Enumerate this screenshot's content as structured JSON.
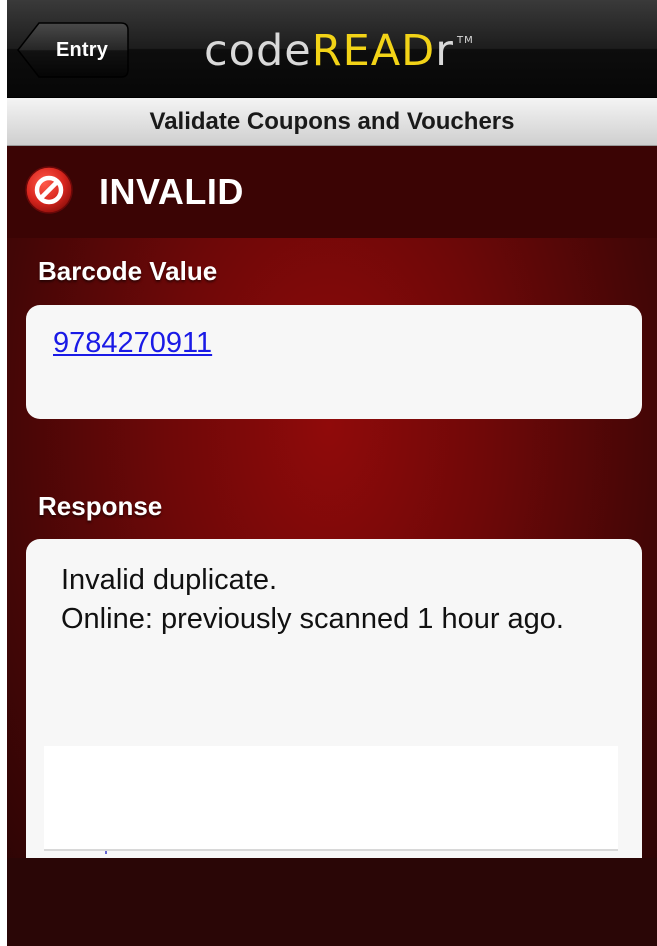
{
  "navbar": {
    "back_label": "Entry",
    "logo_code": "code",
    "logo_read": "READ",
    "logo_r": "r",
    "logo_tm": "TM"
  },
  "subtitle": "Validate Coupons and Vouchers",
  "status": {
    "icon": "no-entry-icon",
    "text": "INVALID"
  },
  "barcode": {
    "label": "Barcode Value",
    "value": "9784270911"
  },
  "response": {
    "label": "Response",
    "lines": [
      "Invalid duplicate.",
      "Online: previously scanned 1 hour ago."
    ]
  },
  "colors": {
    "background_accent": "#900a0a",
    "logo_yellow": "#f2d317",
    "link_blue": "#1a1ae6",
    "status_icon_red": "#d8261e"
  }
}
